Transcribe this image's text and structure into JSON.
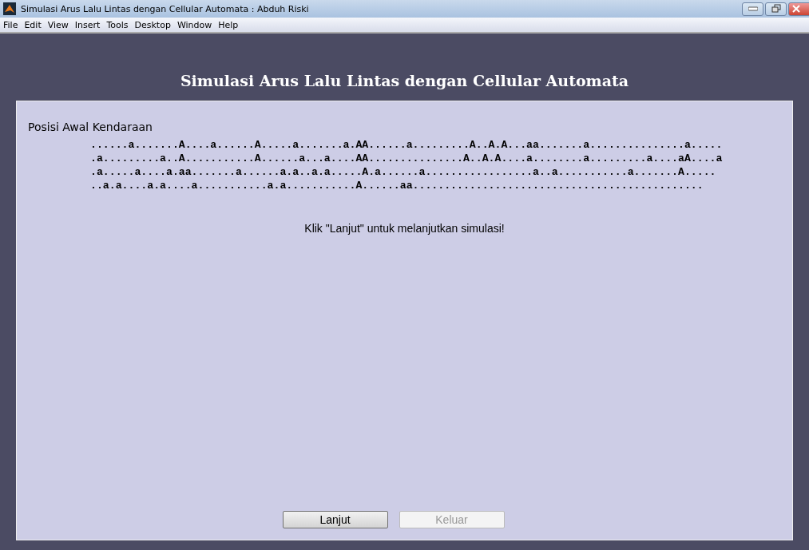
{
  "window": {
    "title": "Simulasi Arus Lalu Lintas dengan Cellular Automata : Abduh Riski"
  },
  "menu": [
    "File",
    "Edit",
    "View",
    "Insert",
    "Tools",
    "Desktop",
    "Window",
    "Help"
  ],
  "heading": "Simulasi Arus Lalu Lintas dengan Cellular Automata",
  "panel": {
    "title": "Posisi Awal Kendaraan",
    "rows": [
      "......a.......A....a......A.....a.......a.AA......a.........A..A.A...aa.......a...............a.....",
      ".a.........a..A...........A......a...a....AA...............A..A.A....a........a.........a....aA....a",
      ".a.....a....a.aa.......a......a.a..a.a.....A.a......a.................a..a...........a.......A.....",
      "..a.a....a.a....a...........a.a...........A......aa.............................................."
    ],
    "message": "Klik \"Lanjut\" untuk melanjutkan simulasi!"
  },
  "buttons": [
    {
      "label": "Lanjut",
      "disabled": false
    },
    {
      "label": "Keluar",
      "disabled": true
    }
  ]
}
